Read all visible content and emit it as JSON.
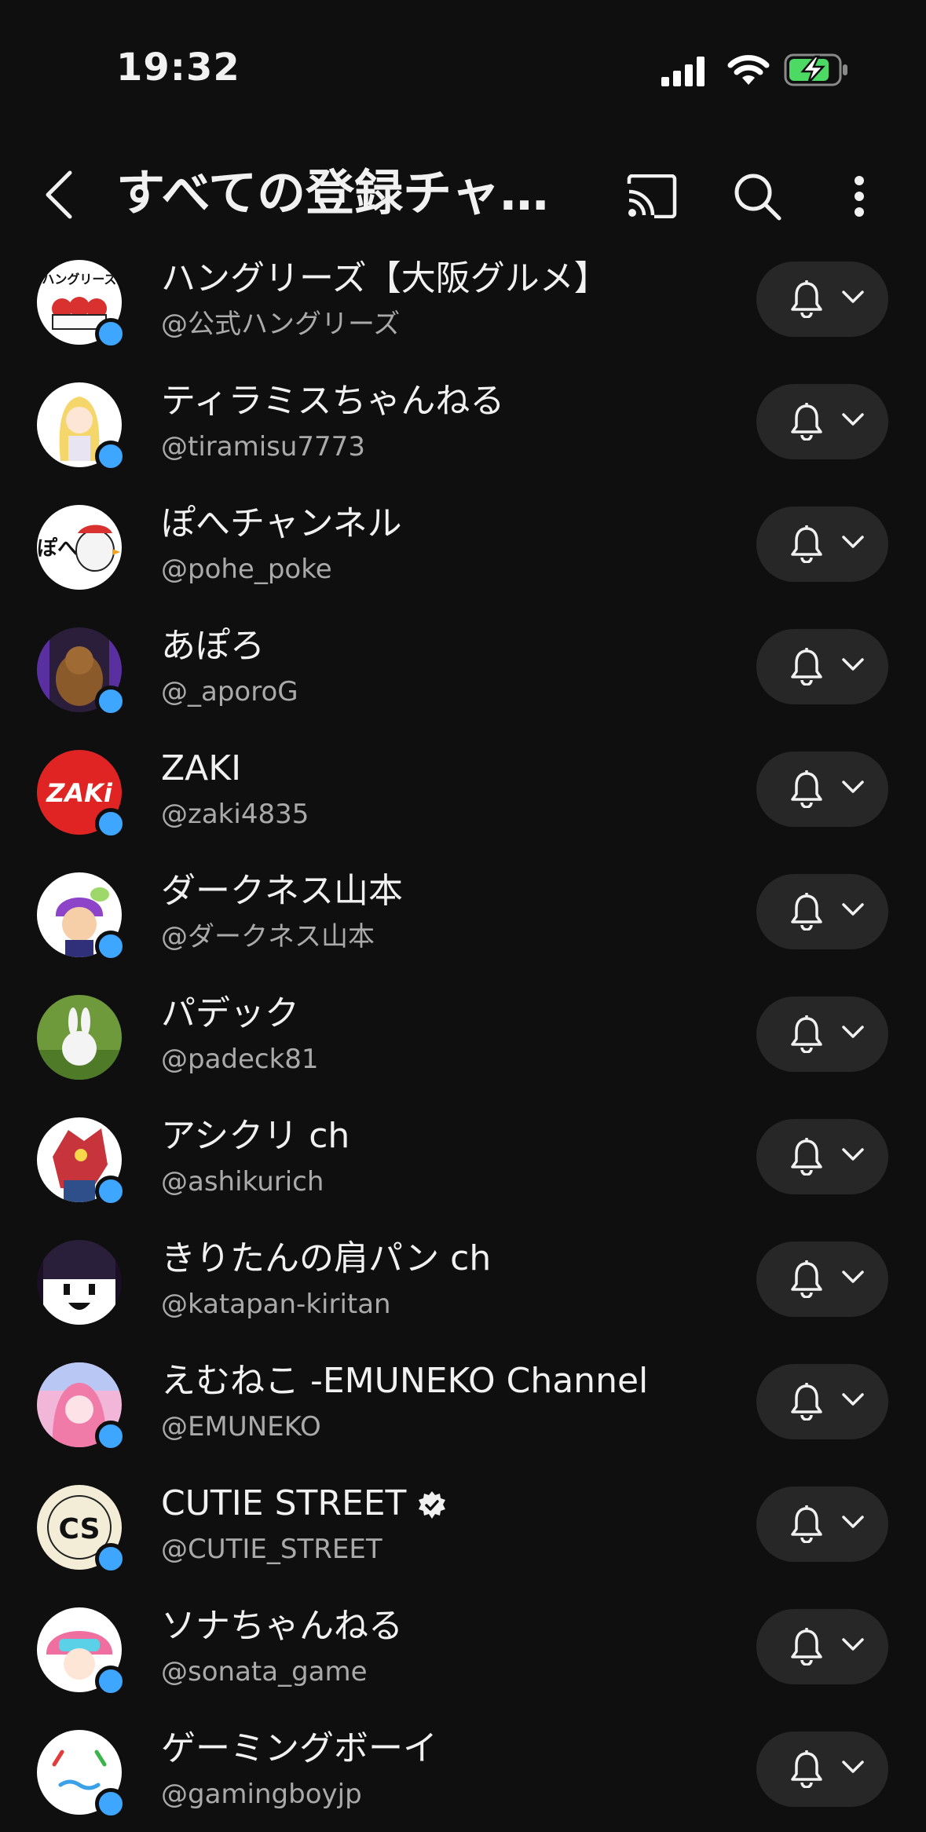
{
  "status_bar": {
    "time": "19:32"
  },
  "header": {
    "title": "すべての登録チャ…",
    "icons": [
      "back-arrow-icon",
      "cast-icon",
      "search-icon",
      "more-vert-icon"
    ]
  },
  "colors": {
    "background": "#0f0f0f",
    "button_bg": "#272727",
    "live_dot": "#3ea6ff",
    "secondary_text": "#aaaaaa"
  },
  "channels": [
    {
      "name": "ハングリーズ【大阪グルメ】",
      "handle": "@公式ハングリーズ"
    },
    {
      "name": "ティラミスちゃんねる",
      "handle": "@tiramisu7773"
    },
    {
      "name": "ぽへチャンネル",
      "handle": "@pohe_poke"
    },
    {
      "name": "あぽろ",
      "handle": "@_aporoG"
    },
    {
      "name": "ZAKI",
      "handle": "@zaki4835"
    },
    {
      "name": "ダークネス山本",
      "handle": "@ダークネス山本"
    },
    {
      "name": "パデック",
      "handle": "@padeck81"
    },
    {
      "name": "アシクリ ch",
      "handle": "@ashikurich"
    },
    {
      "name": "きりたんの肩パン ch",
      "handle": "@katapan-kiritan"
    },
    {
      "name": "えむねこ -EMUNEKO Channel",
      "handle": "@EMUNEKO"
    },
    {
      "name": "CUTIE STREET",
      "handle": "@CUTIE_STREET"
    },
    {
      "name": "ソナちゃんねる",
      "handle": "@sonata_game"
    },
    {
      "name": "ゲーミングボーイ",
      "handle": "@gamingboyjp"
    }
  ],
  "avatar_texts": {
    "hungries": "ハングリーズ",
    "pohe": "ぽへ",
    "zaki": "ZAKi",
    "cutie": "CS"
  }
}
